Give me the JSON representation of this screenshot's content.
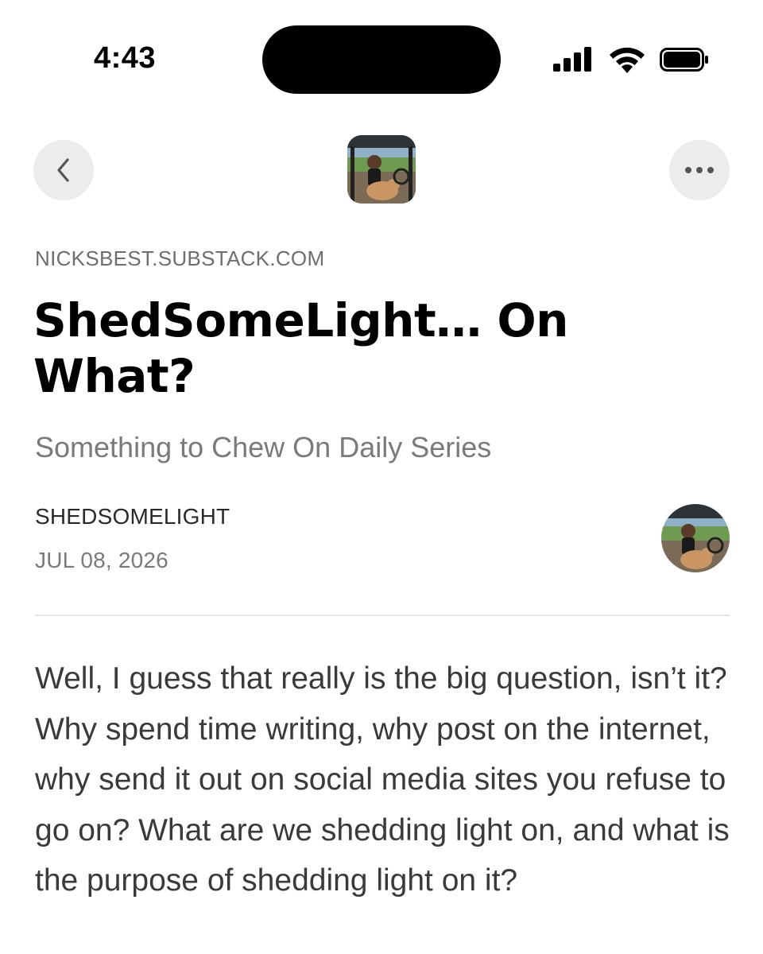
{
  "status_bar": {
    "time": "4:43"
  },
  "nav": {
    "back_icon": "chevron-left-icon",
    "more_icon": "ellipsis-icon"
  },
  "post": {
    "domain": "NICKSBEST.SUBSTACK.COM",
    "title": "ShedSomeLight… On What?",
    "subtitle": "Something to Chew On Daily Series",
    "author": "SHEDSOMELIGHT",
    "date": "JUL 08, 2026",
    "body": "Well, I guess that really is the big question, isn’t it? Why spend time writing, why post on the internet, why send it out on social media sites you refuse to go on? What are we shedding light on, and what is the purpose of shedding light on it?"
  },
  "colors": {
    "nav_button_bg": "#ececec",
    "muted_text": "#7a7a7a",
    "divider": "#e4e4e4"
  }
}
